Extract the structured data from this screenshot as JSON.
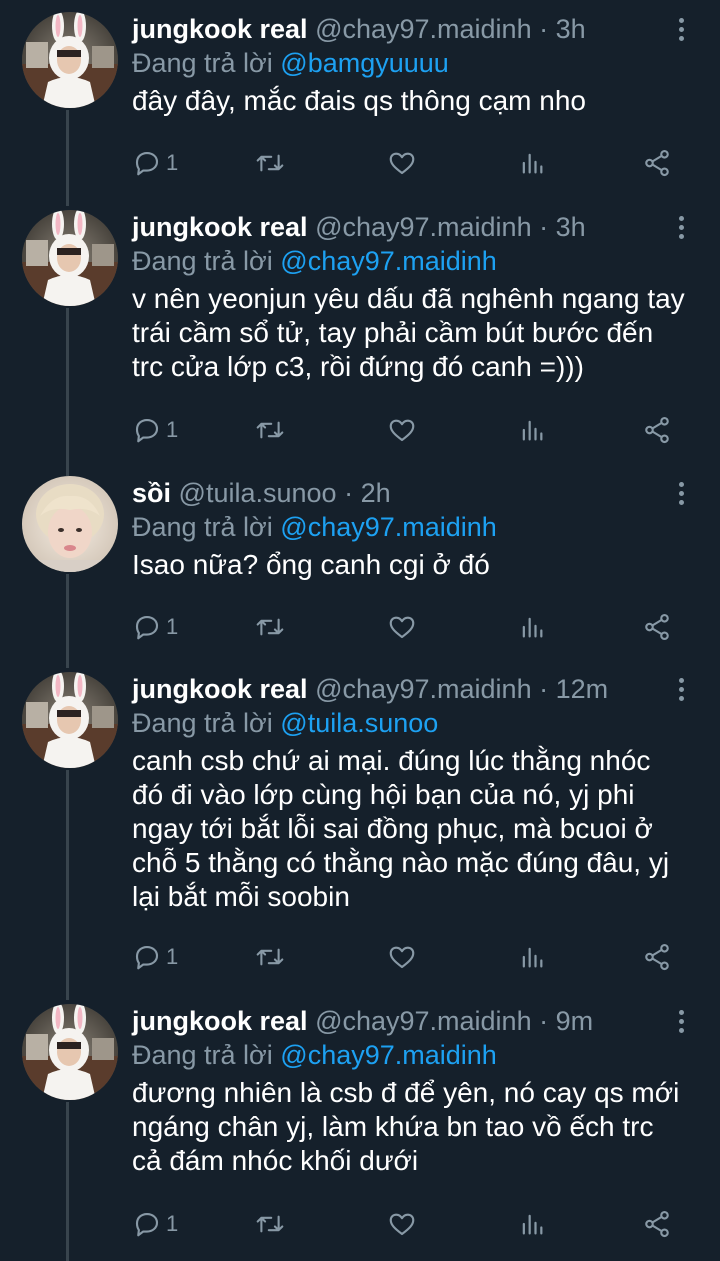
{
  "colors": {
    "background": "#15202b",
    "text_primary": "#ffffff",
    "text_secondary": "#8899a6",
    "link": "#1da1f2",
    "thread_line": "#38444d"
  },
  "replying_prefix": "Đang trả lời",
  "icons": {
    "reply": "reply-icon",
    "retweet": "retweet-icon",
    "like": "heart-icon",
    "analytics": "analytics-icon",
    "share": "share-icon",
    "more": "more-vertical-icon"
  },
  "tweets": [
    {
      "name": "jungkook real",
      "handle": "@chay97.maidinh",
      "sep": "·",
      "time": "3h",
      "replying_to": "@bamgyuuuu",
      "text": "đây đây, mắc đais qs thông cạm nho",
      "reply_count": "1",
      "avatar": "bunny-hood"
    },
    {
      "name": "jungkook real",
      "handle": "@chay97.maidinh",
      "sep": "·",
      "time": "3h",
      "replying_to": "@chay97.maidinh",
      "text": "v nên yeonjun yêu dấu đã nghênh ngang tay trái cầm sổ tử, tay phải cầm bút bước đến trc cửa lớp c3, rồi đứng đó canh =)))",
      "reply_count": "1",
      "avatar": "bunny-hood"
    },
    {
      "name": "sồi",
      "handle": "@tuila.sunoo",
      "sep": "·",
      "time": "2h",
      "replying_to": "@chay97.maidinh",
      "text": "Isao nữa? ổng canh cgi ở đó",
      "reply_count": "1",
      "avatar": "blond"
    },
    {
      "name": "jungkook real",
      "handle": "@chay97.maidinh",
      "sep": "·",
      "time": "12m",
      "replying_to": "@tuila.sunoo",
      "text": "canh csb chứ ai mại. đúng lúc thằng nhóc đó đi vào lớp cùng hội bạn của nó, yj phi ngay tới bắt lỗi sai đồng phục, mà bcuoi ở chỗ 5 thằng có thằng nào mặc đúng đâu, yj lại bắt mỗi soobin",
      "reply_count": "1",
      "avatar": "bunny-hood"
    },
    {
      "name": "jungkook real",
      "handle": "@chay97.maidinh",
      "sep": "·",
      "time": "9m",
      "replying_to": "@chay97.maidinh",
      "text": "đương nhiên là csb đ để yên, nó cay qs mới ngáng chân yj, làm khứa bn tao vồ ếch trc cả đám nhóc khối dưới",
      "reply_count": "1",
      "avatar": "bunny-hood"
    }
  ]
}
